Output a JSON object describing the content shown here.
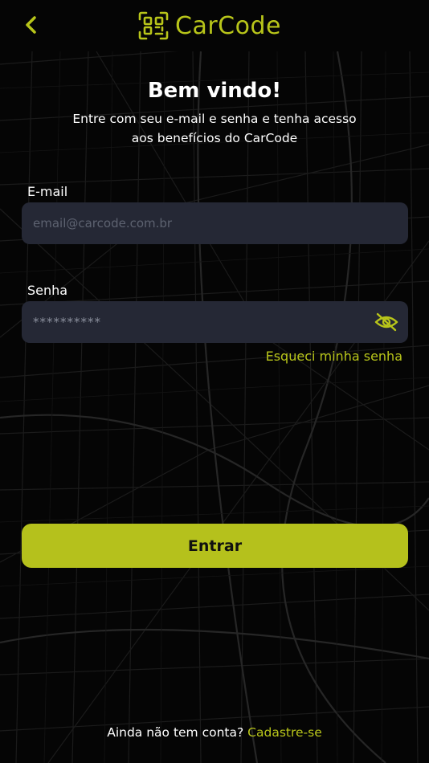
{
  "header": {
    "back_icon": "chevron-left-icon",
    "logo_icon": "qr-code-icon",
    "logo_text": "CarCode"
  },
  "welcome": {
    "title": "Bem vindo!",
    "subtitle_line1": "Entre com seu e-mail e senha e tenha acesso",
    "subtitle_line2": "aos benefícios do  CarCode"
  },
  "form": {
    "email_label": "E-mail",
    "email_placeholder": "email@carcode.com.br",
    "password_label": "Senha",
    "password_placeholder": "**********",
    "toggle_visibility_icon": "eye-off-icon",
    "forgot_password": "Esqueci minha senha",
    "submit_label": "Entrar"
  },
  "footer": {
    "no_account_text": "Ainda não tem conta?",
    "signup_link": "Cadastre-se"
  },
  "colors": {
    "accent": "#b8c51a",
    "button": "#b5c11c",
    "input_bg": "#252835",
    "background": "#050505"
  }
}
